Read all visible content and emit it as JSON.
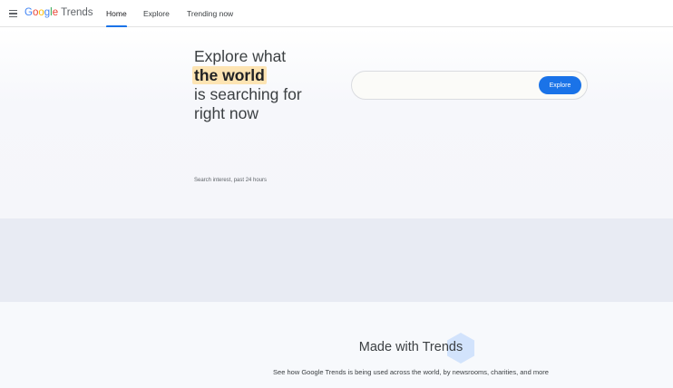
{
  "header": {
    "logo": {
      "google": "Google",
      "trends": "Trends"
    },
    "tabs": [
      {
        "label": "Home",
        "active": true
      },
      {
        "label": "Explore",
        "active": false
      },
      {
        "label": "Trending now",
        "active": false
      }
    ]
  },
  "hero": {
    "headline_line1": "Explore what",
    "headline_highlight": "the world",
    "headline_line3": "is searching for",
    "headline_line4": "right now",
    "search": {
      "value": "",
      "placeholder": "",
      "button_label": "Explore"
    },
    "interest_label": "Search interest, past 24 hours"
  },
  "made_with": {
    "title": "Made with Trends",
    "subtitle": "See how Google Trends is being used across the world, by newsrooms, charities, and more"
  },
  "colors": {
    "accent": "#1a73e8",
    "highlight": "#fde4b3",
    "band": "#e8ebf3",
    "hexagon": "#d2e3fc"
  },
  "icons": {
    "menu": "hamburger-menu-icon",
    "decor": "hexagon-icon"
  }
}
